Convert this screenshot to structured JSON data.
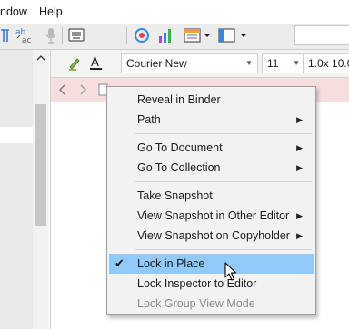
{
  "menubar": {
    "items": [
      "ndow",
      "Help"
    ]
  },
  "format_bar": {
    "font_name": "Courier New",
    "font_size": "11",
    "line_spacing": "1.0x 10.0"
  },
  "context_menu": {
    "items": [
      {
        "label": "Reveal in Binder"
      },
      {
        "label": "Path"
      },
      {
        "label": "Go To Document"
      },
      {
        "label": "Go To Collection"
      },
      {
        "label": "Take Snapshot"
      },
      {
        "label": "View Snapshot in Other Editor"
      },
      {
        "label": "View Snapshot on Copyholder"
      },
      {
        "label": "Lock in Place",
        "checked": true,
        "highlighted": true
      },
      {
        "label": "Lock Inspector to Editor"
      },
      {
        "label": "Lock Group View Mode",
        "disabled": true
      }
    ],
    "highlight_color": "#91c9f7"
  },
  "colors": {
    "nav_bar_bg": "#f7dede",
    "accent": "#91c9f7"
  }
}
